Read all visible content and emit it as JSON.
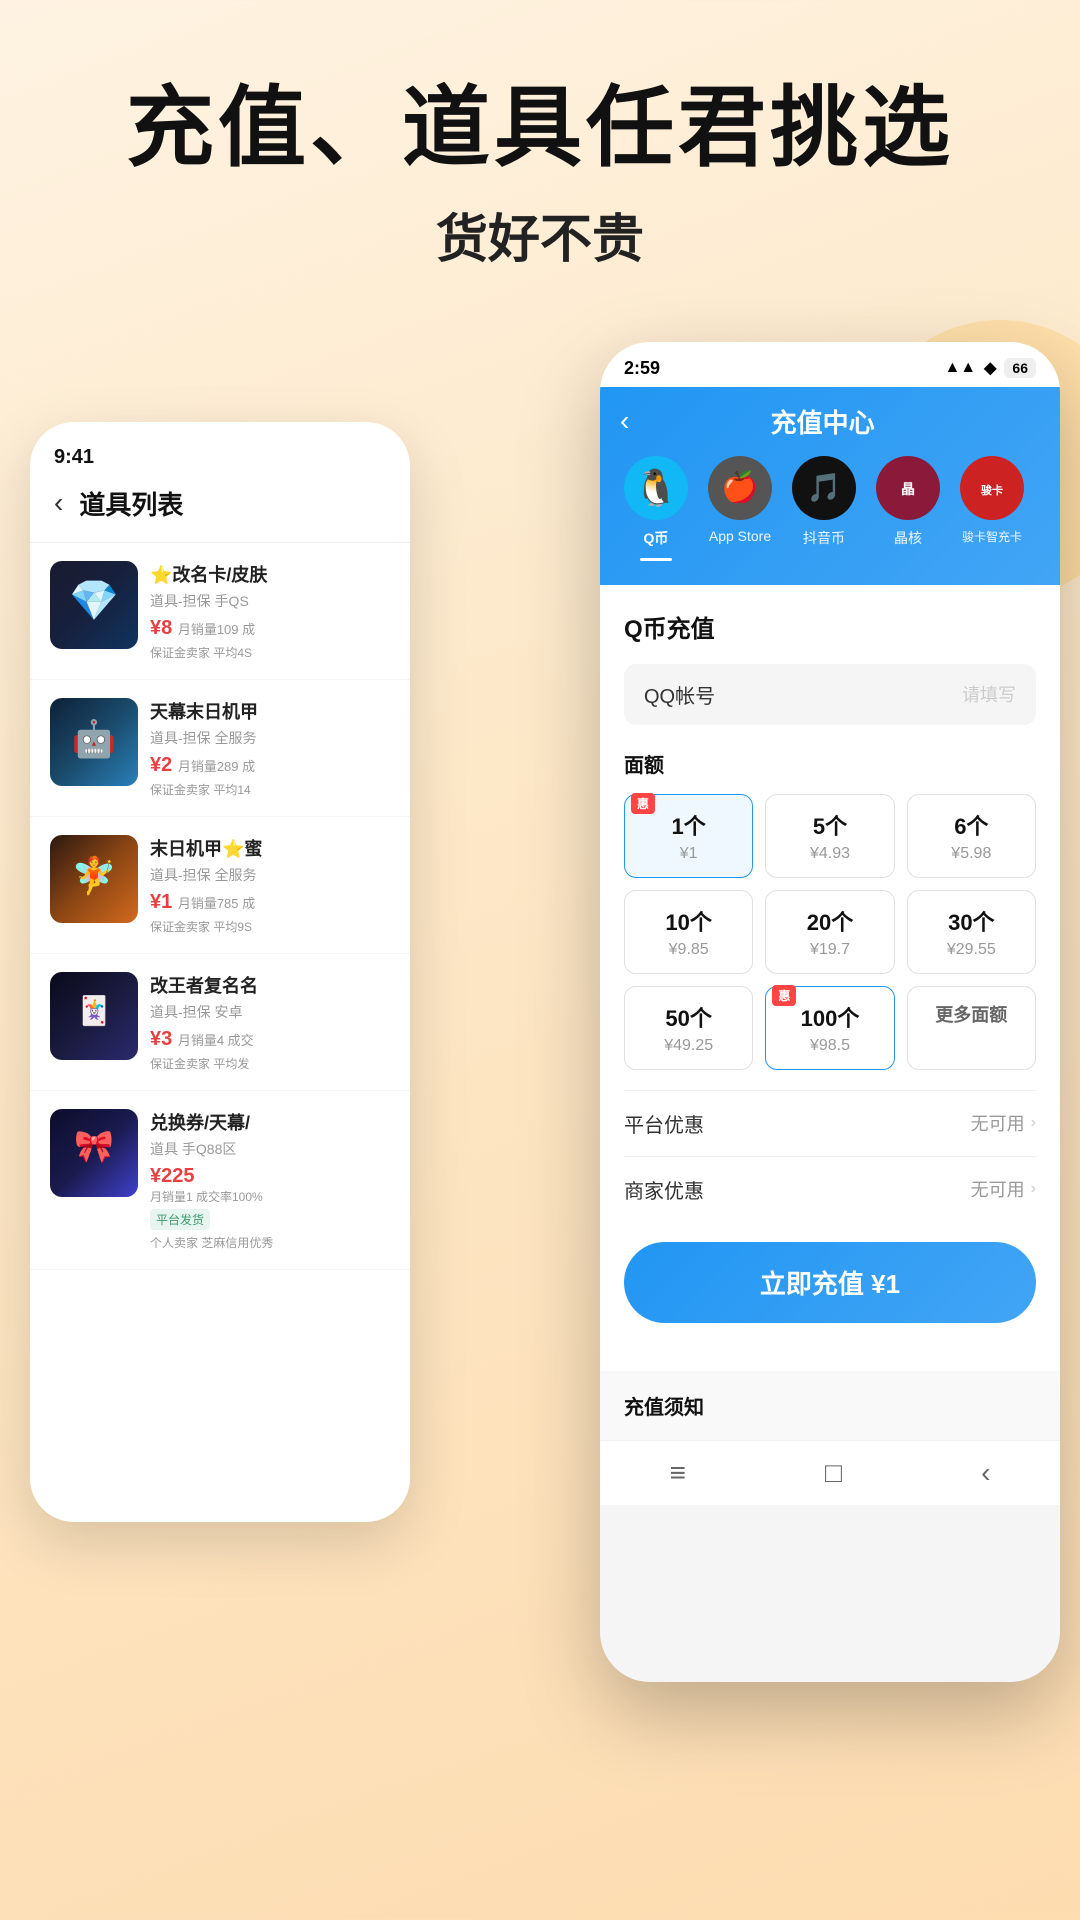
{
  "header": {
    "title_line1": "充值、道具任君挑选",
    "title_line2": "货好不贵"
  },
  "back_phone": {
    "status_time": "9:41",
    "title": "道具列表",
    "items": [
      {
        "id": 1,
        "name": "⭐改名卡/皮肤",
        "desc": "道具-担保 手QS",
        "price": "¥8",
        "sales": "月销量109 成",
        "tag": "保证金卖家 平均4S",
        "bg": "bg1"
      },
      {
        "id": 2,
        "name": "天幕末日机甲",
        "desc": "道具-担保 全服务",
        "price": "¥2",
        "sales": "月销量289 成",
        "tag": "保证金卖家 平均14",
        "bg": "bg2"
      },
      {
        "id": 3,
        "name": "末日机甲⭐蜜",
        "desc": "道具-担保 全服务",
        "price": "¥1",
        "sales": "月销量785 成",
        "tag": "保证金卖家 平均9S",
        "bg": "bg3"
      },
      {
        "id": 4,
        "name": "改王者复名名",
        "desc": "道具-担保 安卓",
        "price": "¥3",
        "sales": "月销量4 成交",
        "tag": "保证金卖家 平均发",
        "bg": "bg4"
      },
      {
        "id": 5,
        "name": "兑换券/天幕/",
        "desc": "道具 手Q88区",
        "price": "¥225",
        "sales": "月销量1 成交率100%",
        "tag": "个人卖家 芝麻信用优秀",
        "platform_tag": "平台发货",
        "bg": "bg5"
      }
    ]
  },
  "front_phone": {
    "status_time": "2:59",
    "status_icons": "▲▲ ◆ 66",
    "title": "充值中心",
    "categories": [
      {
        "id": "qq",
        "label": "Q币",
        "icon": "🐧",
        "active": true
      },
      {
        "id": "apple",
        "label": "App Store",
        "icon": "🍎",
        "active": false
      },
      {
        "id": "tiktok",
        "label": "抖音币",
        "icon": "♪",
        "active": false
      },
      {
        "id": "jinghe",
        "label": "晶核",
        "icon": "💎",
        "active": false
      },
      {
        "id": "junka",
        "label": "骏卡智充卡",
        "icon": "J",
        "active": false
      }
    ],
    "section_title": "Q币充值",
    "input_label": "QQ帐号",
    "input_placeholder": "请填写",
    "amounts_label": "面额",
    "amounts": [
      {
        "main": "1个",
        "sub": "¥1",
        "selected": true,
        "badge": "惠"
      },
      {
        "main": "5个",
        "sub": "¥4.93",
        "selected": false,
        "badge": null
      },
      {
        "main": "6个",
        "sub": "¥5.98",
        "selected": false,
        "badge": null
      },
      {
        "main": "10个",
        "sub": "¥9.85",
        "selected": false,
        "badge": null
      },
      {
        "main": "20个",
        "sub": "¥19.7",
        "selected": false,
        "badge": null
      },
      {
        "main": "30个",
        "sub": "¥29.55",
        "selected": false,
        "badge": null
      },
      {
        "main": "50个",
        "sub": "¥49.25",
        "selected": false,
        "badge": null
      },
      {
        "main": "100个",
        "sub": "¥98.5",
        "selected": false,
        "badge": "惠"
      },
      {
        "main": "更多面额",
        "sub": "",
        "selected": false,
        "badge": null
      }
    ],
    "platform_discount_label": "平台优惠",
    "platform_discount_val": "无可用",
    "merchant_discount_label": "商家优惠",
    "merchant_discount_val": "无可用",
    "cta_label": "立即充值 ¥1",
    "notice_title": "充值须知",
    "bottom_nav": [
      "≡",
      "□",
      "<"
    ]
  }
}
